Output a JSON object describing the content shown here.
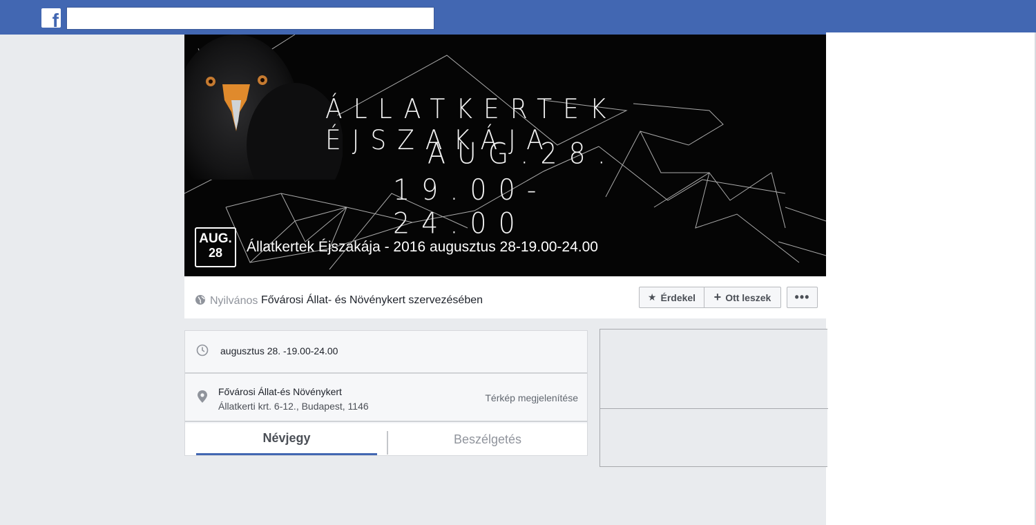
{
  "header": {
    "logo_letter": "f",
    "search_value": "",
    "search_placeholder": ""
  },
  "cover": {
    "line1": "ÁLLATKERTEK ÉJSZAKÁJA",
    "line2": "AUG.28.",
    "line3": "19.00-24.00",
    "date_month": "AUG.",
    "date_day": "28",
    "event_title": "Állatkertek Éjszakája - 2016 augusztus 28-19.00-24.00"
  },
  "infobar": {
    "privacy": "Nyilvános",
    "organizer": "Fővárosi Állat- és Növénykert szervezésében",
    "interested_label": "Érdekel",
    "going_label": "Ott leszek",
    "more_label": "•••"
  },
  "details": {
    "time": "augusztus 28. -19.00-24.00",
    "place_name": "Fővárosi Állat-és Növénykert",
    "place_address": "Állatkerti krt. 6-12., Budapest, 1146",
    "map_link": "Térkép megjelenítése"
  },
  "tabs": [
    {
      "label": "Névjegy",
      "active": true
    },
    {
      "label": "Beszélgetés",
      "active": false
    }
  ],
  "colors": {
    "brand": "#4267b2",
    "page_bg": "#e9ebee"
  }
}
